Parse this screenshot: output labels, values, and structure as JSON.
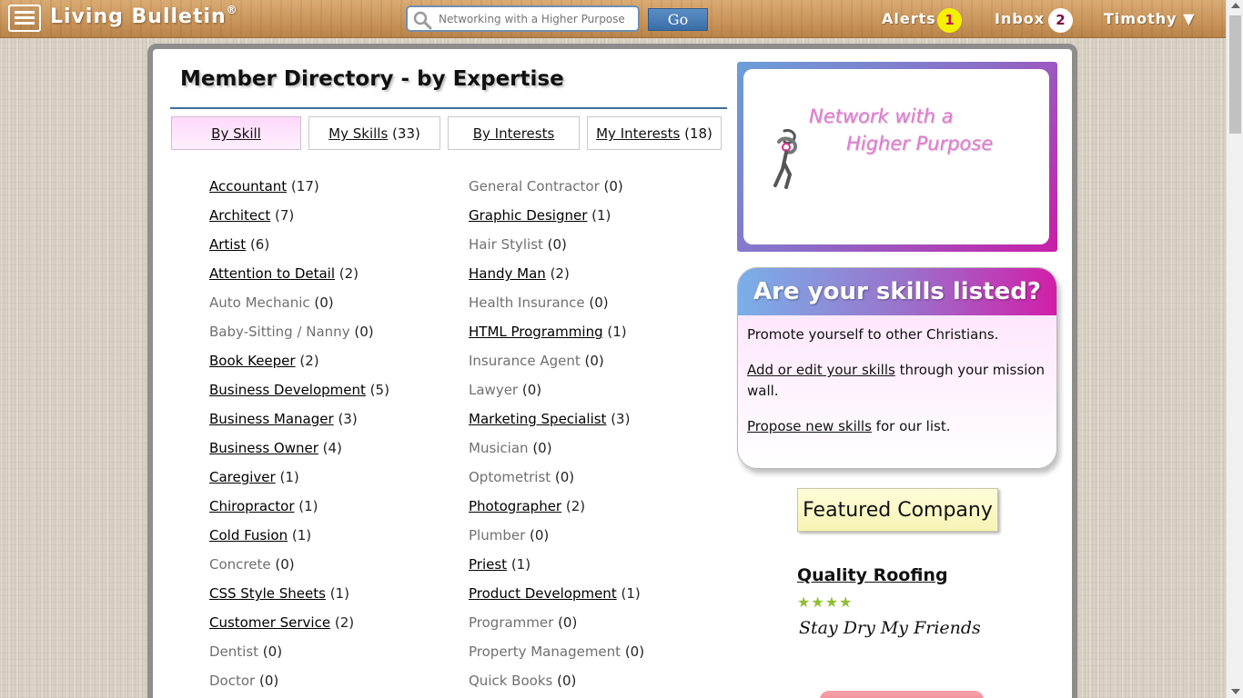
{
  "header": {
    "brand": "Living Bulletin",
    "brand_mark": "®",
    "search_placeholder": "Networking with a Higher Purpose",
    "go_label": "Go",
    "alerts_label": "Alerts",
    "alerts_count": "1",
    "inbox_label": "Inbox",
    "inbox_count": "2",
    "user_label": "Timothy ▼"
  },
  "page": {
    "title": "Member Directory -  by Expertise"
  },
  "tabs": [
    {
      "label": "By Skill",
      "count": ""
    },
    {
      "label": "My Skills",
      "count": " (33)"
    },
    {
      "label": "By Interests",
      "count": ""
    },
    {
      "label": "My Interests",
      "count": " (18)"
    }
  ],
  "skills": {
    "left": [
      {
        "name": "Accountant",
        "count": " (17)"
      },
      {
        "name": "Architect",
        "count": " (7)"
      },
      {
        "name": "Artist",
        "count": " (6)"
      },
      {
        "name": "Attention to Detail",
        "count": " (2)"
      },
      {
        "name": "Auto Mechanic",
        "count": " (0)"
      },
      {
        "name": "Baby-Sitting / Nanny",
        "count": " (0)"
      },
      {
        "name": "Book Keeper",
        "count": " (2)"
      },
      {
        "name": "Business Development",
        "count": " (5)"
      },
      {
        "name": "Business Manager",
        "count": " (3)"
      },
      {
        "name": "Business Owner",
        "count": " (4)"
      },
      {
        "name": "Caregiver",
        "count": " (1)"
      },
      {
        "name": "Chiropractor",
        "count": " (1)"
      },
      {
        "name": "Cold Fusion",
        "count": " (1)"
      },
      {
        "name": "Concrete",
        "count": " (0)"
      },
      {
        "name": "CSS Style Sheets",
        "count": " (1)"
      },
      {
        "name": "Customer Service",
        "count": " (2)"
      },
      {
        "name": "Dentist",
        "count": " (0)"
      },
      {
        "name": "Doctor",
        "count": " (0)"
      }
    ],
    "right": [
      {
        "name": "General Contractor",
        "count": " (0)"
      },
      {
        "name": "Graphic Designer",
        "count": " (1)"
      },
      {
        "name": "Hair Stylist",
        "count": " (0)"
      },
      {
        "name": "Handy Man",
        "count": " (2)"
      },
      {
        "name": "Health Insurance",
        "count": " (0)"
      },
      {
        "name": "HTML Programming",
        "count": " (1)"
      },
      {
        "name": "Insurance Agent",
        "count": " (0)"
      },
      {
        "name": "Lawyer",
        "count": " (0)"
      },
      {
        "name": "Marketing Specialist",
        "count": " (3)"
      },
      {
        "name": "Musician",
        "count": " (0)"
      },
      {
        "name": "Optometrist",
        "count": " (0)"
      },
      {
        "name": "Photographer",
        "count": " (2)"
      },
      {
        "name": "Plumber",
        "count": " (0)"
      },
      {
        "name": "Priest",
        "count": " (1)"
      },
      {
        "name": "Product Development",
        "count": " (1)"
      },
      {
        "name": "Programmer",
        "count": " (0)"
      },
      {
        "name": "Property Management",
        "count": " (0)"
      },
      {
        "name": "Quick Books",
        "count": " (0)"
      }
    ]
  },
  "banner": {
    "line1": "Network with a",
    "line2": "Higher Purpose"
  },
  "skills_box": {
    "heading": "Are your skills listed?",
    "p1": "Promote yourself to other Christians.",
    "p2_link": "Add or edit your skills",
    "p2_rest": " through your mission wall.",
    "p3_link": "Propose new skills",
    "p3_rest": " for our list."
  },
  "featured": {
    "label": "Featured Company",
    "company": "Quality Roofing",
    "stars": "★★★★",
    "rating": 4,
    "slogan": "Stay Dry My Friends"
  },
  "colors": {
    "accent_blue": "#3f6e99",
    "accent_magenta": "#c81ea8",
    "alert_badge": "#f5f000",
    "star_green": "#8fbf2f"
  }
}
